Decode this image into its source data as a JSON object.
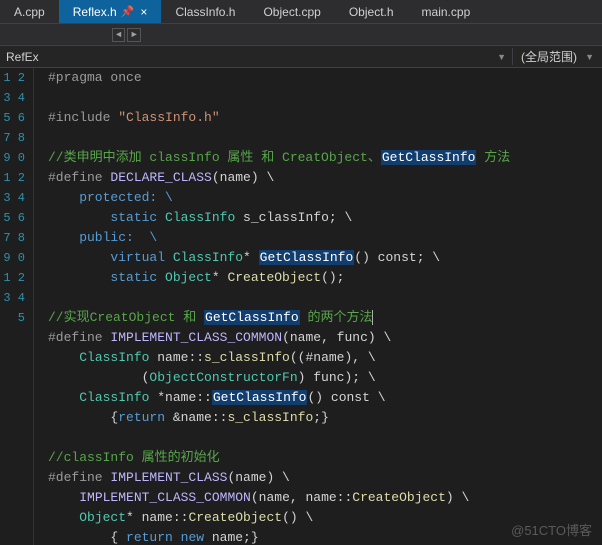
{
  "tabs": [
    {
      "label": "A.cpp",
      "active": false
    },
    {
      "label": "Reflex.h",
      "active": true
    },
    {
      "label": "ClassInfo.h",
      "active": false
    },
    {
      "label": "Object.cpp",
      "active": false
    },
    {
      "label": "Object.h",
      "active": false
    },
    {
      "label": "main.cpp",
      "active": false
    }
  ],
  "nav": {
    "left": "RefEx",
    "right": "(全局范围)"
  },
  "lines": {
    "start": 1,
    "end": 25
  },
  "code": {
    "l1_pragma": "#pragma once",
    "l3_include1": "#include ",
    "l3_include2": "\"ClassInfo.h\"",
    "l5_cmt1": "//类申明中添加 classInfo 属性 和 CreatObject、",
    "l5_hl": "GetClassInfo",
    "l5_cmt2": " 方法",
    "l6_def": "#define ",
    "l6_mac": "DECLARE_CLASS",
    "l6_rest": "(name) \\",
    "l7": "    protected: \\",
    "l8a": "        static ",
    "l8b": "ClassInfo",
    "l8c": " s_classInfo; \\",
    "l9": "    public:  \\",
    "l10a": "        virtual ",
    "l10b": "ClassInfo",
    "l10c": "* ",
    "l10hl": "GetClassInfo",
    "l10d": "() const; \\",
    "l11a": "        static ",
    "l11b": "Object",
    "l11c": "* ",
    "l11d": "CreateObject",
    "l11e": "();",
    "l13a": "//实现CreatObject 和 ",
    "l13hl": "GetClassInfo",
    "l13b": " 的两个方法",
    "l14_def": "#define ",
    "l14_mac": "IMPLEMENT_CLASS_COMMON",
    "l14_rest": "(name, func) \\",
    "l15a": "    ",
    "l15b": "ClassInfo",
    "l15c": " name::",
    "l15d": "s_classInfo",
    "l15e": "((#name), \\",
    "l16a": "            (",
    "l16b": "ObjectConstructorFn",
    "l16c": ") func); \\",
    "l17a": "    ",
    "l17b": "ClassInfo",
    "l17c": " *name::",
    "l17hl": "GetClassInfo",
    "l17d": "() const \\",
    "l18a": "        {",
    "l18b": "return",
    "l18c": " &name::",
    "l18d": "s_classInfo",
    "l18e": ";}",
    "l20": "//classInfo 属性的初始化",
    "l21_def": "#define ",
    "l21_mac": "IMPLEMENT_CLASS",
    "l21_rest": "(name) \\",
    "l22a": "    ",
    "l22b": "IMPLEMENT_CLASS_COMMON",
    "l22c": "(name, name::",
    "l22d": "CreateObject",
    "l22e": ") \\",
    "l23a": "    ",
    "l23b": "Object",
    "l23c": "* name::",
    "l23d": "CreateObject",
    "l23e": "() \\",
    "l24a": "        { ",
    "l24b": "return",
    "l24c": " ",
    "l24d": "new",
    "l24e": " name;}"
  },
  "watermark": "@51CTO博客"
}
